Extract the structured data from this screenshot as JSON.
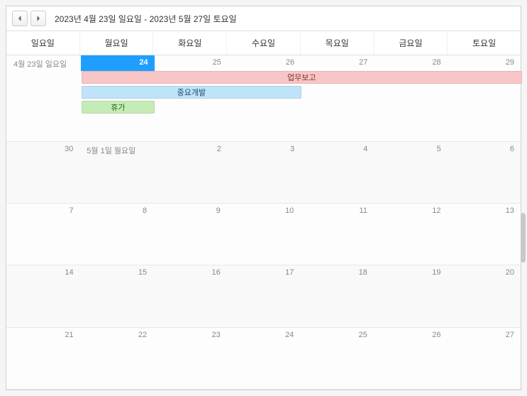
{
  "toolbar": {
    "date_range": "2023년 4월 23일 일요일 - 2023년 5월 27일 토요일"
  },
  "day_headers": [
    "일요일",
    "월요일",
    "화요일",
    "수요일",
    "목요일",
    "금요일",
    "토요일"
  ],
  "weeks": [
    {
      "days": [
        {
          "label": "4월 23일 일요일",
          "first": true
        },
        {
          "label": "24",
          "today": true
        },
        {
          "label": "25"
        },
        {
          "label": "26"
        },
        {
          "label": "27"
        },
        {
          "label": "28"
        },
        {
          "label": "29"
        }
      ],
      "events": [
        {
          "title": "업무보고",
          "color": "pink",
          "start": 1,
          "end": 7,
          "row": 0
        },
        {
          "title": "중요개발",
          "color": "blue",
          "start": 1,
          "end": 4,
          "row": 1
        },
        {
          "title": "휴가",
          "color": "green",
          "start": 1,
          "end": 2,
          "row": 2
        }
      ]
    },
    {
      "days": [
        {
          "label": "30"
        },
        {
          "label": "5월 1일 월요일",
          "first": true
        },
        {
          "label": "2"
        },
        {
          "label": "3"
        },
        {
          "label": "4"
        },
        {
          "label": "5"
        },
        {
          "label": "6"
        }
      ],
      "events": []
    },
    {
      "days": [
        {
          "label": "7"
        },
        {
          "label": "8"
        },
        {
          "label": "9"
        },
        {
          "label": "10"
        },
        {
          "label": "11"
        },
        {
          "label": "12"
        },
        {
          "label": "13"
        }
      ],
      "events": []
    },
    {
      "days": [
        {
          "label": "14"
        },
        {
          "label": "15"
        },
        {
          "label": "16"
        },
        {
          "label": "17"
        },
        {
          "label": "18"
        },
        {
          "label": "19"
        },
        {
          "label": "20"
        }
      ],
      "events": []
    },
    {
      "days": [
        {
          "label": "21"
        },
        {
          "label": "22"
        },
        {
          "label": "23"
        },
        {
          "label": "24"
        },
        {
          "label": "25"
        },
        {
          "label": "26"
        },
        {
          "label": "27"
        }
      ],
      "events": []
    }
  ]
}
